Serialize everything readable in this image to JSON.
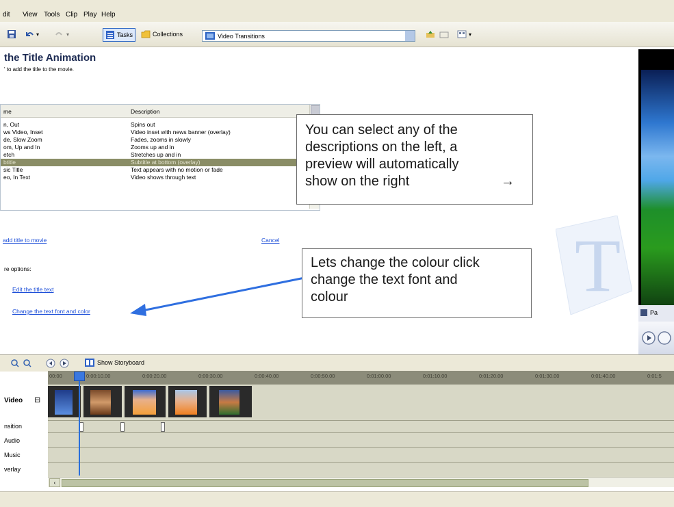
{
  "menu": [
    "dit",
    "View",
    "Tools",
    "Clip",
    "Play",
    "Help"
  ],
  "toolbar": {
    "tasks_label": "Tasks",
    "collections_label": "Collections",
    "collection_selected": "Video Transitions"
  },
  "task_pane": {
    "title": "the Title Animation",
    "subtitle": "' to add the title to the movie.",
    "list": {
      "headers": [
        "me",
        "Description"
      ],
      "rows": [
        {
          "name": "n, Out",
          "desc": "Spins out"
        },
        {
          "name": "ws Video, Inset",
          "desc": "Video inset with news banner (overlay)"
        },
        {
          "name": "de, Slow Zoom",
          "desc": "Fades, zooms in slowly"
        },
        {
          "name": "om, Up and In",
          "desc": "Zooms up and in"
        },
        {
          "name": "etch",
          "desc": "Stretches up and in"
        },
        {
          "name": "btitle",
          "desc": "Subtitle at bottom (overlay)",
          "selected": true
        },
        {
          "name": "sic Title",
          "desc": "Text appears with no motion or fade"
        },
        {
          "name": "eo, In Text",
          "desc": "Video shows through text"
        }
      ]
    },
    "done_link": "add title to movie",
    "cancel_link": "Cancel",
    "more_options": "re options:",
    "edit_link": "Edit the title text",
    "font_link": "Change the text font and color"
  },
  "callouts": {
    "preview": [
      "You can select any of the",
      "descriptions on the left, a",
      "preview will automatically",
      "show on the right"
    ],
    "preview_arrow": "→",
    "colour": [
      "Lets change the colour click",
      "change the text font and",
      "colour"
    ]
  },
  "monitor": {
    "status_text": "Pa"
  },
  "timeline": {
    "show_storyboard": "Show Storyboard",
    "ruler": [
      "00:00",
      "0:00:10.00",
      "0:00:20.00",
      "0:00:30.00",
      "0:00:40.00",
      "0:00:50.00",
      "0:01:00.00",
      "0:01:10.00",
      "0:01:20.00",
      "0:01:30.00",
      "0:01:40.00",
      "0:01:5"
    ],
    "tracks": [
      "Video",
      "nsition",
      "Audio",
      "Music",
      "verlay"
    ],
    "expand_symbol": "⊟"
  },
  "colors": {
    "selected_row": "#8a8d66",
    "link": "#1c4ed8",
    "arrow": "#2f6fe0",
    "playhead": "#2a6fdb"
  }
}
